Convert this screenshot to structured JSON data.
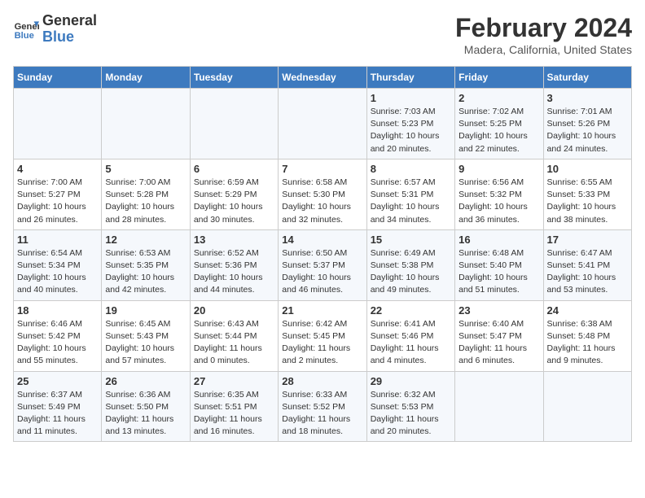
{
  "logo": {
    "line1": "General",
    "line2": "Blue"
  },
  "title": "February 2024",
  "subtitle": "Madera, California, United States",
  "days_of_week": [
    "Sunday",
    "Monday",
    "Tuesday",
    "Wednesday",
    "Thursday",
    "Friday",
    "Saturday"
  ],
  "weeks": [
    [
      {
        "day": "",
        "info": ""
      },
      {
        "day": "",
        "info": ""
      },
      {
        "day": "",
        "info": ""
      },
      {
        "day": "",
        "info": ""
      },
      {
        "day": "1",
        "info": "Sunrise: 7:03 AM\nSunset: 5:23 PM\nDaylight: 10 hours\nand 20 minutes."
      },
      {
        "day": "2",
        "info": "Sunrise: 7:02 AM\nSunset: 5:25 PM\nDaylight: 10 hours\nand 22 minutes."
      },
      {
        "day": "3",
        "info": "Sunrise: 7:01 AM\nSunset: 5:26 PM\nDaylight: 10 hours\nand 24 minutes."
      }
    ],
    [
      {
        "day": "4",
        "info": "Sunrise: 7:00 AM\nSunset: 5:27 PM\nDaylight: 10 hours\nand 26 minutes."
      },
      {
        "day": "5",
        "info": "Sunrise: 7:00 AM\nSunset: 5:28 PM\nDaylight: 10 hours\nand 28 minutes."
      },
      {
        "day": "6",
        "info": "Sunrise: 6:59 AM\nSunset: 5:29 PM\nDaylight: 10 hours\nand 30 minutes."
      },
      {
        "day": "7",
        "info": "Sunrise: 6:58 AM\nSunset: 5:30 PM\nDaylight: 10 hours\nand 32 minutes."
      },
      {
        "day": "8",
        "info": "Sunrise: 6:57 AM\nSunset: 5:31 PM\nDaylight: 10 hours\nand 34 minutes."
      },
      {
        "day": "9",
        "info": "Sunrise: 6:56 AM\nSunset: 5:32 PM\nDaylight: 10 hours\nand 36 minutes."
      },
      {
        "day": "10",
        "info": "Sunrise: 6:55 AM\nSunset: 5:33 PM\nDaylight: 10 hours\nand 38 minutes."
      }
    ],
    [
      {
        "day": "11",
        "info": "Sunrise: 6:54 AM\nSunset: 5:34 PM\nDaylight: 10 hours\nand 40 minutes."
      },
      {
        "day": "12",
        "info": "Sunrise: 6:53 AM\nSunset: 5:35 PM\nDaylight: 10 hours\nand 42 minutes."
      },
      {
        "day": "13",
        "info": "Sunrise: 6:52 AM\nSunset: 5:36 PM\nDaylight: 10 hours\nand 44 minutes."
      },
      {
        "day": "14",
        "info": "Sunrise: 6:50 AM\nSunset: 5:37 PM\nDaylight: 10 hours\nand 46 minutes."
      },
      {
        "day": "15",
        "info": "Sunrise: 6:49 AM\nSunset: 5:38 PM\nDaylight: 10 hours\nand 49 minutes."
      },
      {
        "day": "16",
        "info": "Sunrise: 6:48 AM\nSunset: 5:40 PM\nDaylight: 10 hours\nand 51 minutes."
      },
      {
        "day": "17",
        "info": "Sunrise: 6:47 AM\nSunset: 5:41 PM\nDaylight: 10 hours\nand 53 minutes."
      }
    ],
    [
      {
        "day": "18",
        "info": "Sunrise: 6:46 AM\nSunset: 5:42 PM\nDaylight: 10 hours\nand 55 minutes."
      },
      {
        "day": "19",
        "info": "Sunrise: 6:45 AM\nSunset: 5:43 PM\nDaylight: 10 hours\nand 57 minutes."
      },
      {
        "day": "20",
        "info": "Sunrise: 6:43 AM\nSunset: 5:44 PM\nDaylight: 11 hours\nand 0 minutes."
      },
      {
        "day": "21",
        "info": "Sunrise: 6:42 AM\nSunset: 5:45 PM\nDaylight: 11 hours\nand 2 minutes."
      },
      {
        "day": "22",
        "info": "Sunrise: 6:41 AM\nSunset: 5:46 PM\nDaylight: 11 hours\nand 4 minutes."
      },
      {
        "day": "23",
        "info": "Sunrise: 6:40 AM\nSunset: 5:47 PM\nDaylight: 11 hours\nand 6 minutes."
      },
      {
        "day": "24",
        "info": "Sunrise: 6:38 AM\nSunset: 5:48 PM\nDaylight: 11 hours\nand 9 minutes."
      }
    ],
    [
      {
        "day": "25",
        "info": "Sunrise: 6:37 AM\nSunset: 5:49 PM\nDaylight: 11 hours\nand 11 minutes."
      },
      {
        "day": "26",
        "info": "Sunrise: 6:36 AM\nSunset: 5:50 PM\nDaylight: 11 hours\nand 13 minutes."
      },
      {
        "day": "27",
        "info": "Sunrise: 6:35 AM\nSunset: 5:51 PM\nDaylight: 11 hours\nand 16 minutes."
      },
      {
        "day": "28",
        "info": "Sunrise: 6:33 AM\nSunset: 5:52 PM\nDaylight: 11 hours\nand 18 minutes."
      },
      {
        "day": "29",
        "info": "Sunrise: 6:32 AM\nSunset: 5:53 PM\nDaylight: 11 hours\nand 20 minutes."
      },
      {
        "day": "",
        "info": ""
      },
      {
        "day": "",
        "info": ""
      }
    ]
  ]
}
